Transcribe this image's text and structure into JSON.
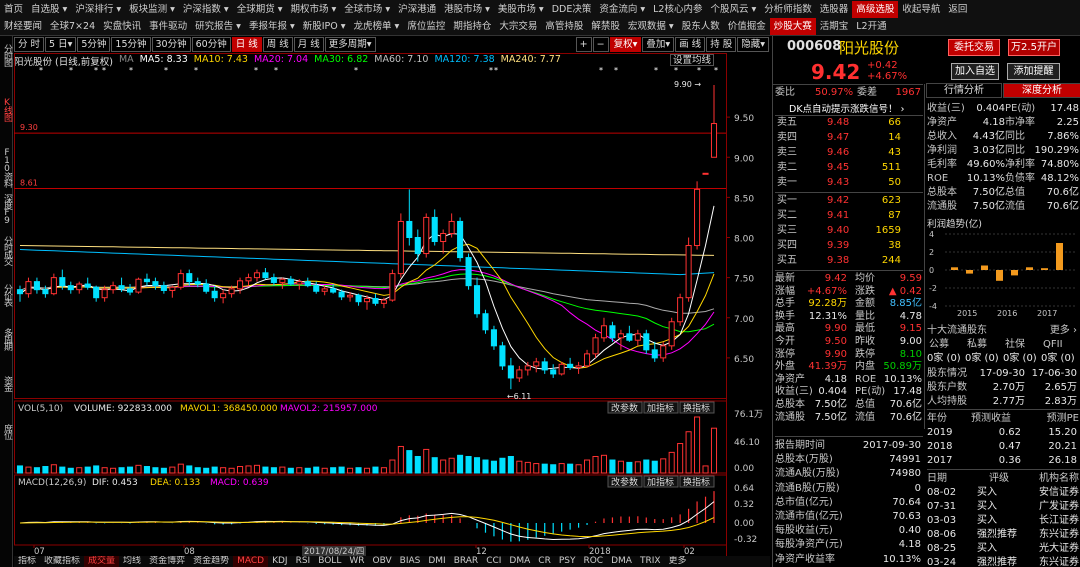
{
  "menu_row1": [
    "首页",
    "自选股 ▾",
    "沪深排行 ▾",
    "板块监测 ▾",
    "沪深指数 ▾",
    "全球期货 ▾",
    "期权市场 ▾",
    "全球市场 ▾",
    "沪深港通",
    "港股市场 ▾",
    "美股市场 ▾",
    "DDE决策",
    "资金流向 ▾",
    "L2核心内参",
    "个股风云 ▾",
    "分析师指数",
    "选股器",
    "高级选股",
    "收起导航",
    "返回"
  ],
  "menu_row2": [
    "财经要闻",
    "全球7×24",
    "实盘快讯",
    "事件驱动",
    "研究报告 ▾",
    "季报年报 ▾",
    "新股IPO ▾",
    "龙虎榜单 ▾",
    "席位监控",
    "期指持仓",
    "大宗交易",
    "高管持股",
    "解禁股",
    "宏观数据 ▾",
    "股东人数",
    "价值掘金",
    "炒股大赛",
    "活期宝",
    "L2开通"
  ],
  "left_tabs": [
    {
      "label": "分时图",
      "active": false
    },
    {
      "label": "K线图",
      "active": true
    },
    {
      "label": "F10资料",
      "active": false
    },
    {
      "label": "深度F9",
      "active": false
    },
    {
      "label": "分时成交",
      "active": false
    },
    {
      "label": "分价表",
      "active": false
    },
    {
      "label": "多周期",
      "active": false
    },
    {
      "label": "资金",
      "active": false
    },
    {
      "label": "席位",
      "active": false
    }
  ],
  "toolbar": {
    "periods": [
      "分 时",
      "5 日▾",
      "5分钟",
      "15分钟",
      "30分钟",
      "60分钟",
      "日 线",
      "周 线",
      "月 线",
      "更多周期▾"
    ],
    "active_period": "日 线",
    "right_buttons": [
      "+",
      "−",
      "复权▾",
      "叠加▾",
      "画 线",
      "持 股",
      "隐藏▾"
    ]
  },
  "ma_bar": {
    "stock": "阳光股份 (日线,前复权)",
    "ma_label": "MA",
    "ma5": "MA5: 8.33",
    "ma10": "MA10: 7.43",
    "ma20": "MA20: 7.04",
    "ma30": "MA30: 6.82",
    "ma60": "MA60: 7.10",
    "ma120": "MA120: 7.38",
    "ma240": "MA240: 7.77",
    "settings": "设置均线"
  },
  "price_axis": [
    "9.50",
    "9.00",
    "8.50",
    "8.00",
    "7.50",
    "7.00",
    "6.50"
  ],
  "levels": {
    "high_line": "9.30",
    "low_line": "8.61",
    "peak": "9.90",
    "bottom": "6.11"
  },
  "volume": {
    "title": "VOL(5,10)",
    "volume": "VOLUME: 922833.000",
    "mavol1": "MAVOL1: 368450.000",
    "mavol2": "MAVOL2: 215957.000",
    "buttons": [
      "改参数",
      "加指标",
      "换指标"
    ],
    "axis": [
      "76.1万",
      "46.10",
      "0.00"
    ]
  },
  "macd": {
    "title": "MACD(12,26,9)",
    "dif": "DIF: 0.453",
    "dea": "DEA: 0.133",
    "macd": "MACD: 0.639",
    "axis": [
      "0.64",
      "0.32",
      "0.00",
      "-0.32"
    ]
  },
  "x_axis": {
    "labels": [
      "07",
      "08",
      "2017/08/24/四",
      "12",
      "2018",
      "02"
    ]
  },
  "bottom_tabs": [
    "指标",
    "收藏指标",
    "成交量",
    "均线",
    "资金博弈",
    "资金趋势",
    "MACD",
    "KDJ",
    "RSI",
    "BOLL",
    "WR",
    "OBV",
    "BIAS",
    "DMI",
    "BRAR",
    "CCI",
    "DMA",
    "CR",
    "PSY",
    "ROC",
    "DMA",
    "TRIX",
    "更多"
  ],
  "colors": {
    "up": "#ff3232",
    "down": "#00e0ff",
    "ma5": "#ffffff",
    "ma10": "#ffd700",
    "ma20": "#ff00ff",
    "ma30": "#00ff00",
    "ma60": "#aaaaaa",
    "ma120": "#00bfff",
    "ma240": "#ffe080"
  },
  "right": {
    "code": "000608",
    "name": "阳光股份",
    "btn_trade": "委托交易",
    "btn_promo": "万2.5开户",
    "price": "9.42",
    "change": "+0.42",
    "change_pct": "+4.67%",
    "btn_add": "加入自选",
    "btn_alert": "添加提醒",
    "weibi_label": "委比",
    "weibi": "50.97%",
    "weicha_label": "委差",
    "weicha": "1967",
    "dde_link": "DK点自动提示涨跌信号！ ›",
    "sell": [
      {
        "l": "卖五",
        "p": "9.48",
        "v": "66"
      },
      {
        "l": "卖四",
        "p": "9.47",
        "v": "14"
      },
      {
        "l": "卖三",
        "p": "9.46",
        "v": "43"
      },
      {
        "l": "卖二",
        "p": "9.45",
        "v": "511"
      },
      {
        "l": "卖一",
        "p": "9.43",
        "v": "50"
      }
    ],
    "buy": [
      {
        "l": "买一",
        "p": "9.42",
        "v": "623"
      },
      {
        "l": "买二",
        "p": "9.41",
        "v": "87"
      },
      {
        "l": "买三",
        "p": "9.40",
        "v": "1659"
      },
      {
        "l": "买四",
        "p": "9.39",
        "v": "38"
      },
      {
        "l": "买五",
        "p": "9.38",
        "v": "244"
      }
    ],
    "quote": [
      {
        "l1": "最新",
        "v1": "9.42",
        "c1": "red",
        "l2": "均价",
        "v2": "9.59",
        "c2": "red"
      },
      {
        "l1": "涨幅",
        "v1": "+4.67%",
        "c1": "red",
        "l2": "涨跌",
        "v2": "▲ 0.42",
        "c2": "red"
      },
      {
        "l1": "总手",
        "v1": "92.28万",
        "c1": "yellow",
        "l2": "金额",
        "v2": "8.85亿",
        "c2": "cyan"
      },
      {
        "l1": "换手",
        "v1": "12.31%",
        "c1": "white",
        "l2": "量比",
        "v2": "4.78",
        "c2": "white"
      },
      {
        "l1": "最高",
        "v1": "9.90",
        "c1": "red",
        "l2": "最低",
        "v2": "9.15",
        "c2": "red"
      },
      {
        "l1": "今开",
        "v1": "9.50",
        "c1": "red",
        "l2": "昨收",
        "v2": "9.00",
        "c2": "white"
      },
      {
        "l1": "涨停",
        "v1": "9.90",
        "c1": "red",
        "l2": "跌停",
        "v2": "8.10",
        "c2": "green"
      },
      {
        "l1": "外盘",
        "v1": "41.39万",
        "c1": "red",
        "l2": "内盘",
        "v2": "50.89万",
        "c2": "green"
      },
      {
        "l1": "净资产",
        "v1": "4.18",
        "c1": "white",
        "l2": "ROE",
        "v2": "10.13%",
        "c2": "white"
      },
      {
        "l1": "收益(三)",
        "v1": "0.404",
        "c1": "white",
        "l2": "PE(动)",
        "v2": "17.48",
        "c2": "white"
      },
      {
        "l1": "总股本",
        "v1": "7.50亿",
        "c1": "white",
        "l2": "总值",
        "v2": "70.6亿",
        "c2": "white"
      },
      {
        "l1": "流通股",
        "v1": "7.50亿",
        "c1": "white",
        "l2": "流值",
        "v2": "70.6亿",
        "c2": "white"
      }
    ],
    "report": [
      {
        "l": "报告期时间",
        "v": "2017-09-30"
      },
      {
        "l": "总股本(万股)",
        "v": "74991"
      },
      {
        "l": "流通A股(万股)",
        "v": "74980"
      },
      {
        "l": "流通B股(万股)",
        "v": "0"
      },
      {
        "l": "总市值(亿元)",
        "v": "70.64"
      },
      {
        "l": "流通市值(亿元)",
        "v": "70.63"
      },
      {
        "l": "每股收益(元)",
        "v": "0.40"
      },
      {
        "l": "每股净资产(元)",
        "v": "4.18"
      },
      {
        "l": "净资产收益率",
        "v": "10.13%"
      }
    ],
    "tabs2": [
      "行情分析",
      "深度分析"
    ],
    "fin": [
      {
        "l1": "收益(三)",
        "v1": "0.404",
        "l2": "PE(动)",
        "v2": "17.48"
      },
      {
        "l1": "净资产",
        "v1": "4.18",
        "l2": "市净率",
        "v2": "2.25"
      },
      {
        "l1": "总收入",
        "v1": "4.43亿",
        "l2": "同比",
        "v2": "7.86%"
      },
      {
        "l1": "净利润",
        "v1": "3.03亿",
        "l2": "同比",
        "v2": "190.29%"
      },
      {
        "l1": "毛利率",
        "v1": "49.60%",
        "l2": "净利率",
        "v2": "74.80%"
      },
      {
        "l1": "ROE",
        "v1": "10.13%",
        "l2": "负债率",
        "v2": "48.12%"
      },
      {
        "l1": "总股本",
        "v1": "7.50亿",
        "l2": "总值",
        "v2": "70.6亿"
      },
      {
        "l1": "流通股",
        "v1": "7.50亿",
        "l2": "流值",
        "v2": "70.6亿"
      }
    ],
    "profit_title": "利润趋势(亿)",
    "profit_axis": [
      "4",
      "2",
      "0",
      "-2",
      "-4"
    ],
    "profit_years": [
      "2015",
      "2016",
      "2017"
    ],
    "profit_values": [
      0.3,
      -0.4,
      0.5,
      -1.2,
      -0.6,
      0.3,
      0.2,
      3.0
    ],
    "holders_title": "十大流通股东",
    "holders_more": "更多 ›",
    "holders_head": [
      "公募",
      "私募",
      "社保",
      "QFII"
    ],
    "holders_vals": [
      "0家 (0)",
      "0家 (0)",
      "0家 (0)",
      "0家 (0)"
    ],
    "holder_rows": [
      {
        "l": "股东情况",
        "a": "17-09-30",
        "b": "17-06-30"
      },
      {
        "l": "股东户数",
        "a": "2.70万",
        "b": "2.65万"
      },
      {
        "l": "人均持股",
        "a": "2.77万",
        "b": "2.83万"
      }
    ],
    "forecast_head": [
      "年份",
      "预测收益",
      "预测PE"
    ],
    "forecast": [
      {
        "y": "2019",
        "e": "0.62",
        "pe": "15.20"
      },
      {
        "y": "2018",
        "e": "0.47",
        "pe": "20.21"
      },
      {
        "y": "2017",
        "e": "0.36",
        "pe": "26.18"
      }
    ],
    "rating_head": [
      "日期",
      "评级",
      "机构名称"
    ],
    "ratings": [
      {
        "d": "08-02",
        "r": "买入",
        "o": "安信证券"
      },
      {
        "d": "07-31",
        "r": "买入",
        "o": "广发证券"
      },
      {
        "d": "03-03",
        "r": "买入",
        "o": "长江证券"
      },
      {
        "d": "08-06",
        "r": "强烈推荐",
        "o": "东兴证券"
      },
      {
        "d": "08-25",
        "r": "买入",
        "o": "光大证券"
      },
      {
        "d": "03-24",
        "r": "强烈推荐",
        "o": "东兴证券"
      }
    ]
  },
  "candles": [
    [
      7.35,
      7.4,
      7.2,
      7.3
    ],
    [
      7.3,
      7.5,
      7.25,
      7.45
    ],
    [
      7.45,
      7.5,
      7.3,
      7.35
    ],
    [
      7.35,
      7.4,
      7.25,
      7.3
    ],
    [
      7.3,
      7.55,
      7.28,
      7.5
    ],
    [
      7.5,
      7.6,
      7.35,
      7.4
    ],
    [
      7.4,
      7.45,
      7.3,
      7.35
    ],
    [
      7.35,
      7.45,
      7.3,
      7.42
    ],
    [
      7.42,
      7.5,
      7.35,
      7.38
    ],
    [
      7.38,
      7.4,
      7.2,
      7.25
    ],
    [
      7.25,
      7.4,
      7.2,
      7.35
    ],
    [
      7.35,
      7.45,
      7.3,
      7.4
    ],
    [
      7.4,
      7.5,
      7.32,
      7.36
    ],
    [
      7.36,
      7.42,
      7.28,
      7.32
    ],
    [
      7.32,
      7.5,
      7.3,
      7.48
    ],
    [
      7.48,
      7.55,
      7.4,
      7.45
    ],
    [
      7.45,
      7.5,
      7.35,
      7.4
    ],
    [
      7.4,
      7.45,
      7.3,
      7.34
    ],
    [
      7.34,
      7.4,
      7.25,
      7.38
    ],
    [
      7.38,
      7.6,
      7.35,
      7.55
    ],
    [
      7.55,
      7.6,
      7.4,
      7.45
    ],
    [
      7.45,
      7.5,
      7.38,
      7.42
    ],
    [
      7.42,
      7.48,
      7.3,
      7.33
    ],
    [
      7.33,
      7.4,
      7.2,
      7.25
    ],
    [
      7.25,
      7.35,
      7.18,
      7.3
    ],
    [
      7.3,
      7.4,
      7.25,
      7.36
    ],
    [
      7.36,
      7.5,
      7.3,
      7.46
    ],
    [
      7.46,
      7.55,
      7.4,
      7.5
    ],
    [
      7.5,
      7.6,
      7.45,
      7.56
    ],
    [
      7.56,
      7.62,
      7.48,
      7.5
    ],
    [
      7.5,
      7.55,
      7.4,
      7.44
    ],
    [
      7.44,
      7.5,
      7.36,
      7.48
    ],
    [
      7.48,
      7.52,
      7.4,
      7.42
    ],
    [
      7.42,
      7.48,
      7.35,
      7.45
    ],
    [
      7.45,
      7.5,
      7.38,
      7.4
    ],
    [
      7.4,
      7.45,
      7.3,
      7.33
    ],
    [
      7.33,
      7.4,
      7.28,
      7.36
    ],
    [
      7.36,
      7.42,
      7.3,
      7.32
    ],
    [
      7.32,
      7.35,
      7.22,
      7.26
    ],
    [
      7.26,
      7.32,
      7.2,
      7.28
    ],
    [
      7.28,
      7.3,
      7.15,
      7.2
    ],
    [
      7.2,
      7.28,
      7.1,
      7.24
    ],
    [
      7.24,
      7.3,
      7.15,
      7.18
    ],
    [
      7.18,
      7.25,
      7.12,
      7.22
    ],
    [
      7.22,
      7.6,
      7.2,
      7.55
    ],
    [
      7.55,
      8.3,
      7.5,
      8.2
    ],
    [
      8.2,
      8.6,
      7.9,
      8.0
    ],
    [
      8.0,
      8.1,
      7.7,
      7.8
    ],
    [
      7.8,
      8.3,
      7.75,
      8.25
    ],
    [
      8.25,
      8.35,
      7.9,
      7.95
    ],
    [
      7.95,
      8.1,
      7.8,
      8.05
    ],
    [
      8.05,
      8.3,
      8.0,
      8.2
    ],
    [
      8.2,
      8.25,
      7.7,
      7.75
    ],
    [
      7.75,
      7.8,
      7.35,
      7.4
    ],
    [
      7.4,
      7.5,
      7.0,
      7.05
    ],
    [
      7.05,
      7.1,
      6.8,
      6.85
    ],
    [
      6.85,
      6.9,
      6.6,
      6.65
    ],
    [
      6.65,
      6.7,
      6.35,
      6.4
    ],
    [
      6.4,
      6.5,
      6.11,
      6.25
    ],
    [
      6.25,
      6.4,
      6.2,
      6.35
    ],
    [
      6.35,
      6.45,
      6.28,
      6.4
    ],
    [
      6.4,
      6.5,
      6.32,
      6.45
    ],
    [
      6.45,
      6.5,
      6.3,
      6.35
    ],
    [
      6.35,
      6.42,
      6.25,
      6.3
    ],
    [
      6.3,
      6.45,
      6.28,
      6.42
    ],
    [
      6.42,
      6.5,
      6.35,
      6.38
    ],
    [
      6.38,
      6.45,
      6.3,
      6.4
    ],
    [
      6.4,
      6.6,
      6.38,
      6.55
    ],
    [
      6.55,
      6.8,
      6.5,
      6.75
    ],
    [
      6.75,
      7.0,
      6.7,
      6.9
    ],
    [
      6.9,
      6.95,
      6.7,
      6.75
    ],
    [
      6.75,
      6.85,
      6.6,
      6.8
    ],
    [
      6.8,
      6.9,
      6.7,
      6.72
    ],
    [
      6.72,
      6.85,
      6.65,
      6.8
    ],
    [
      6.8,
      6.85,
      6.55,
      6.6
    ],
    [
      6.6,
      6.7,
      6.45,
      6.5
    ],
    [
      6.5,
      6.7,
      6.45,
      6.65
    ],
    [
      6.65,
      7.0,
      6.6,
      6.95
    ],
    [
      6.95,
      7.3,
      6.9,
      7.25
    ],
    [
      7.25,
      8.0,
      7.2,
      7.9
    ],
    [
      7.9,
      8.7,
      7.85,
      8.6
    ],
    [
      8.8,
      8.8,
      8.8,
      8.8
    ],
    [
      9.0,
      9.9,
      9.0,
      9.42
    ]
  ],
  "vol": [
    12,
    10,
    9,
    11,
    14,
    10,
    8,
    9,
    10,
    12,
    9,
    8,
    9,
    10,
    13,
    11,
    9,
    8,
    10,
    15,
    12,
    9,
    8,
    10,
    9,
    8,
    11,
    12,
    13,
    10,
    9,
    10,
    8,
    9,
    8,
    10,
    8,
    9,
    10,
    8,
    9,
    8,
    10,
    9,
    22,
    45,
    38,
    28,
    40,
    26,
    22,
    25,
    30,
    28,
    26,
    22,
    20,
    25,
    28,
    20,
    18,
    16,
    15,
    14,
    16,
    15,
    14,
    22,
    28,
    30,
    22,
    20,
    18,
    19,
    22,
    20,
    24,
    35,
    50,
    70,
    95,
    12,
    76
  ]
}
